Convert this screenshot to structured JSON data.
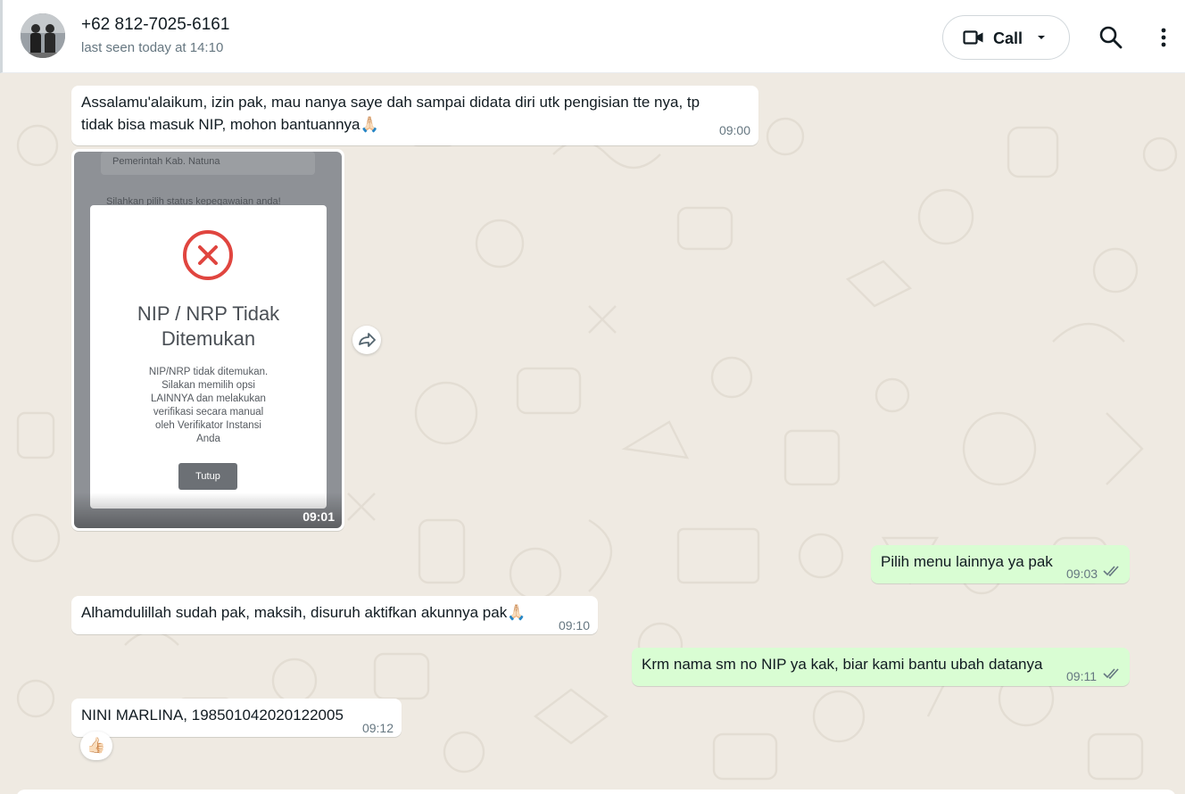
{
  "header": {
    "contact_name": "+62 812-7025-6161",
    "status": "last seen today at 14:10",
    "call_label": "Call"
  },
  "icons": {
    "avatar": "avatar-photo",
    "video_call": "video-camera-icon",
    "caret": "chevron-down-icon",
    "search": "search-icon",
    "menu": "kebab-menu-icon",
    "forward": "forward-icon",
    "read_receipt": "double-check-icon"
  },
  "colors": {
    "chat_bg": "#efeae2",
    "incoming_bubble": "#ffffff",
    "outgoing_bubble": "#d9fdd3",
    "read_check": "#667781",
    "error_red": "#e0453f"
  },
  "messages": [
    {
      "direction": "in",
      "text": "Assalamu'alaikum, izin pak, mau nanya saye dah sampai didata diri utk pengisian tte nya, tp tidak bisa masuk NIP, mohon bantuannya🙏🏻",
      "line1": "Assalamu'alaikum, izin pak, mau nanya saye dah sampai didata diri utk pengisian tte nya, tp",
      "line2": "tidak bisa masuk NIP, mohon bantuannya🙏🏻",
      "time": "09:00"
    },
    {
      "direction": "in",
      "type": "image",
      "time": "09:01",
      "image": {
        "field_text": "Pemerintah Kab. Natuna",
        "sub_text": "Silahkan pilih status kepegawaian anda!",
        "dialog_title_line1": "NIP / NRP Tidak",
        "dialog_title_line2": "Ditemukan",
        "dialog_body_lines": [
          "NIP/NRP tidak ditemukan.",
          "Silakan memilih opsi",
          "LAINNYA dan melakukan",
          "verifikasi secara manual",
          "oleh Verifikator Instansi",
          "Anda"
        ],
        "dialog_button": "Tutup"
      }
    },
    {
      "direction": "out",
      "text": "Pilih menu lainnya ya pak",
      "time": "09:03",
      "status": "read"
    },
    {
      "direction": "in",
      "text": "Alhamdulillah sudah pak, maksih, disuruh aktifkan akunnya pak🙏🏻",
      "time": "09:10"
    },
    {
      "direction": "out",
      "text": "Krm nama sm no NIP ya kak, biar kami bantu ubah datanya",
      "time": "09:11",
      "status": "read"
    },
    {
      "direction": "in",
      "text": "NINI MARLINA, 198501042020122005",
      "time": "09:12",
      "reaction": "👍🏻"
    }
  ]
}
